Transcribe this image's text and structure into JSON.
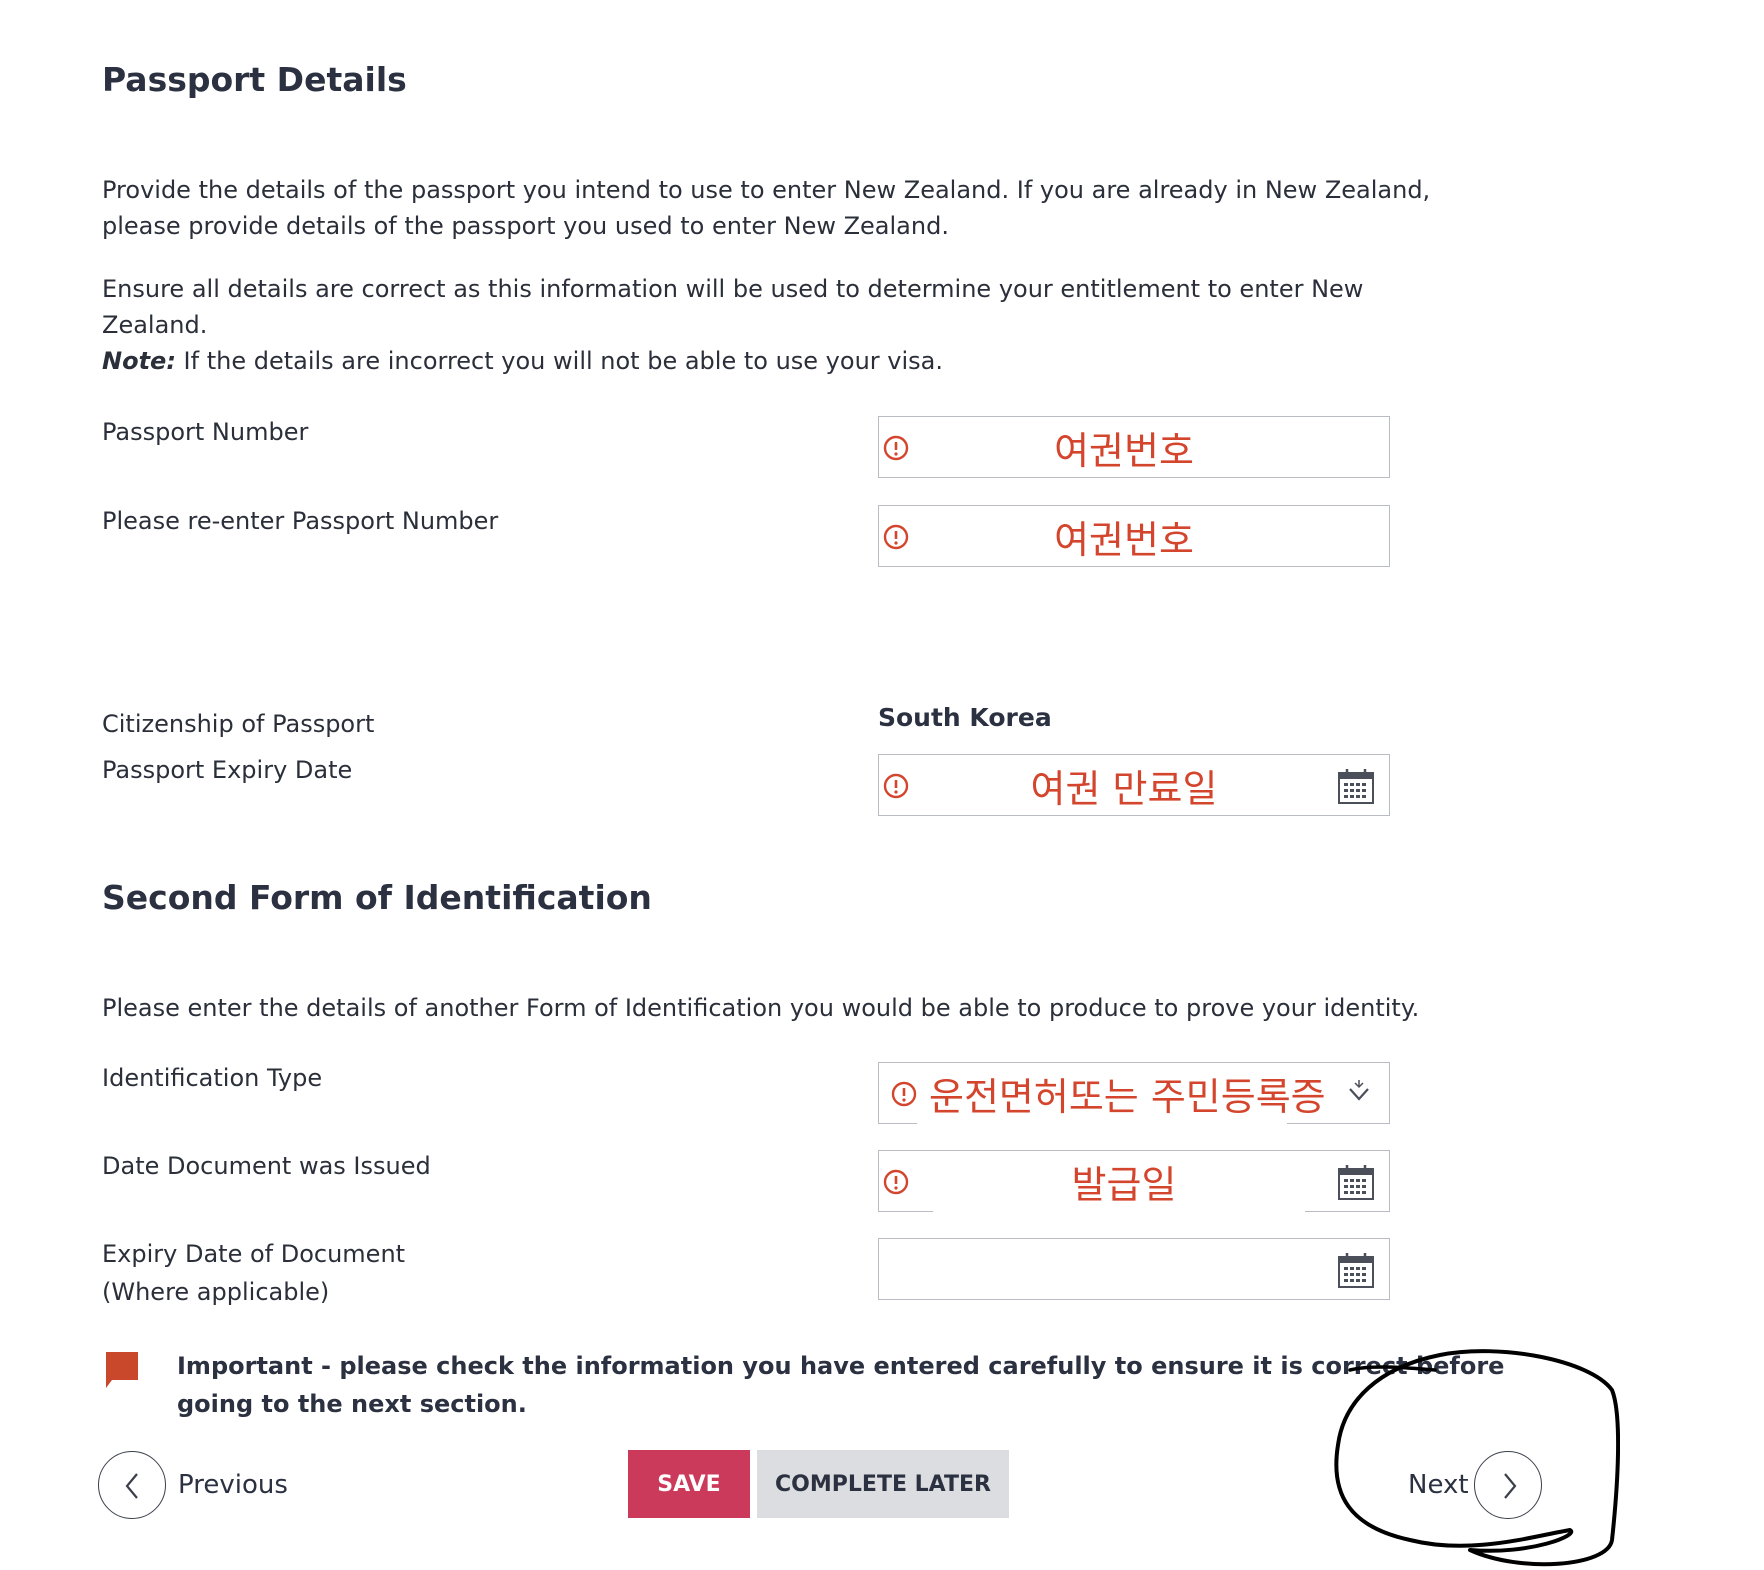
{
  "passport": {
    "title": "Passport Details",
    "intro": "Provide the details of the passport you intend to use to enter New Zealand. If you are already in New Zealand, please provide details of the passport you used to enter New Zealand.",
    "ensure": "Ensure all details are correct as this information will be used to determine your entitlement to enter New Zealand.",
    "note_label": "Note:",
    "note_text": " If the details are incorrect you will not be able to use your visa.",
    "fields": {
      "number": {
        "label": "Passport Number",
        "value": "여권번호"
      },
      "reenter": {
        "label": "Please re-enter Passport Number",
        "value": "여권번호"
      },
      "citizenship": {
        "label": "Citizenship of Passport",
        "value": "South Korea"
      },
      "expiry": {
        "label": "Passport Expiry Date",
        "value": "여권 만료일"
      }
    }
  },
  "second_id": {
    "title": "Second Form of Identification",
    "intro": "Please enter the details of another Form of Identification you would be able to produce to prove your identity.",
    "fields": {
      "type": {
        "label": "Identification Type",
        "value": "운전면허또는 주민등록증"
      },
      "issued": {
        "label": "Date Document was Issued",
        "value": "발급일"
      },
      "expiry": {
        "label_line1": "Expiry Date of Document",
        "label_line2": "(Where applicable)",
        "value": ""
      }
    }
  },
  "important": "Important - please check the information you have entered carefully to ensure it is correct before going to the next section.",
  "nav": {
    "previous": "Previous",
    "save": "SAVE",
    "complete_later": "COMPLETE LATER",
    "next": "Next"
  },
  "icons": {
    "error": "alert-circle-icon",
    "calendar": "calendar-icon",
    "dropdown": "chevron-down-icon",
    "flag": "flag-icon"
  },
  "colors": {
    "error": "#d4452d",
    "save": "#cc3a5b",
    "complete_later": "#dcdde0",
    "flag": "#c9472b"
  }
}
